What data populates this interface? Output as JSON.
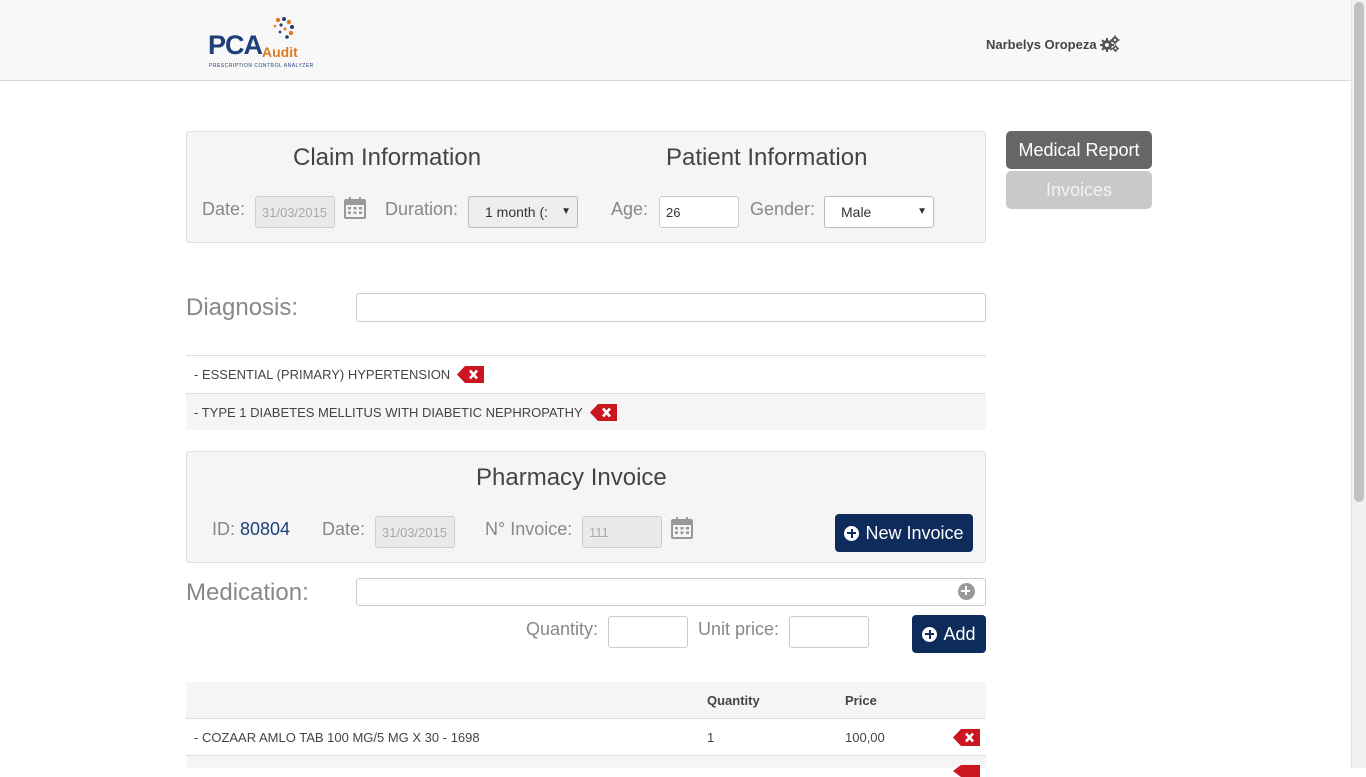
{
  "header": {
    "logo_main": "PCA",
    "logo_sub": "Audit",
    "logo_tagline": "PRESCRIPTION CONTROL ANALYZER",
    "user_name": "Narbelys Oropeza",
    "settings_icon": "gears-icon"
  },
  "claim": {
    "title": "Claim Information",
    "date_label": "Date:",
    "date_value": "31/03/2015",
    "duration_label": "Duration:",
    "duration_value": "1 month (:"
  },
  "patient": {
    "title": "Patient Information",
    "age_label": "Age:",
    "age_value": "26",
    "gender_label": "Gender:",
    "gender_value": "Male"
  },
  "side_nav": {
    "medical_report": "Medical Report",
    "invoices": "Invoices"
  },
  "diagnosis": {
    "label": "Diagnosis:",
    "input_value": "",
    "items": [
      "- ESSENTIAL (PRIMARY) HYPERTENSION",
      "- TYPE 1 DIABETES MELLITUS WITH DIABETIC NEPHROPATHY"
    ]
  },
  "invoice": {
    "title": "Pharmacy Invoice",
    "id_label": "ID:",
    "id_value": "80804",
    "date_label": "Date:",
    "date_value": "31/03/2015",
    "number_label": "N° Invoice:",
    "number_value": "111",
    "new_button": "New Invoice"
  },
  "medication": {
    "label": "Medication:",
    "input_value": "",
    "quantity_label": "Quantity:",
    "quantity_value": "",
    "unit_price_label": "Unit price:",
    "unit_price_value": "",
    "add_button": "Add"
  },
  "table": {
    "columns": [
      "",
      "Quantity",
      "Price"
    ],
    "rows": [
      {
        "name": "- COZAAR AMLO TAB 100 MG/5 MG X 30 - 1698",
        "quantity": "1",
        "price": "100,00"
      }
    ]
  },
  "colors": {
    "navy": "#0d2c5c",
    "delete_red": "#c9161f",
    "brand_blue": "#1e3f7a",
    "brand_orange": "#e07a1f"
  }
}
